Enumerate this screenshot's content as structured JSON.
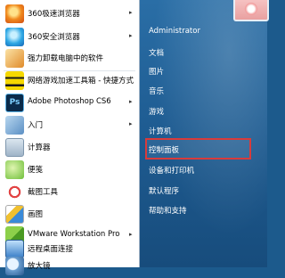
{
  "program_list": [
    {
      "name": "360极速浏览器",
      "icon": "browser-360-speed-icon",
      "has_arrow": true
    },
    {
      "name": "360安全浏览器",
      "icon": "browser-360-safe-icon",
      "has_arrow": true
    },
    {
      "name": "强力卸载电脑中的软件",
      "icon": "uninstall-icon",
      "has_arrow": false
    },
    {
      "name": "网络游戏加速工具箱 - 快捷方式",
      "icon": "network-game-toolbox-icon",
      "has_arrow": false
    },
    {
      "name": "Adobe Photoshop CS6",
      "icon": "photoshop-icon",
      "icon_text": "Ps",
      "has_arrow": true
    },
    {
      "name": "入门",
      "icon": "getting-started-icon",
      "has_arrow": true
    },
    {
      "name": "计算器",
      "icon": "calculator-icon",
      "has_arrow": false
    },
    {
      "name": "便笺",
      "icon": "sticky-notes-icon",
      "has_arrow": false
    },
    {
      "name": "截图工具",
      "icon": "snipping-tool-icon",
      "has_arrow": false
    },
    {
      "name": "画图",
      "icon": "paint-icon",
      "has_arrow": false
    },
    {
      "name": "VMware Workstation Pro",
      "icon": "vmware-icon",
      "has_arrow": true
    },
    {
      "name": "远程桌面连接",
      "icon": "remote-desktop-icon",
      "has_arrow": false
    },
    {
      "name": "放大镜",
      "icon": "magnifier-icon",
      "has_arrow": false
    }
  ],
  "arrow_glyph": "▸",
  "right_pane": {
    "user_picture_icon": "user-picture-icon",
    "items": [
      {
        "label": "Administrator"
      },
      {
        "label": "文档"
      },
      {
        "label": "图片"
      },
      {
        "label": "音乐"
      },
      {
        "label": "游戏"
      },
      {
        "label": "计算机"
      },
      {
        "label": "控制面板",
        "highlighted": true
      },
      {
        "label": "设备和打印机"
      },
      {
        "label": "默认程序"
      },
      {
        "label": "帮助和支持"
      }
    ]
  },
  "colors": {
    "right_pane": "#1f5d93",
    "highlight_border": "#d83b3b",
    "left_pane": "#ffffff"
  }
}
